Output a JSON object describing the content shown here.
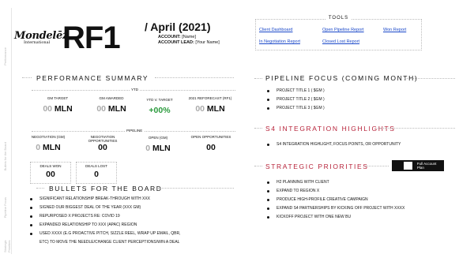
{
  "header": {
    "logo_text": "Mondelēz",
    "logo_sub": "International",
    "title": "RF1",
    "period": "/ April (2021)",
    "account_label": "ACCOUNT:",
    "account_value": "[Name]",
    "lead_label": "ACCOUNT LEAD:",
    "lead_value": "[Your Name]"
  },
  "side_labels": [
    "Strategic Priorities",
    "Pipeline Focus",
    "S4 Integration",
    "Bullets for the Board",
    "Performance",
    "Summary"
  ],
  "tools": {
    "title": "TOOLS",
    "links": [
      "Client Dashboard",
      "Open Pipeline Report",
      "Won Report",
      "In Negotiation Report",
      "Closed Lost Report"
    ]
  },
  "performance": {
    "title": "PERFORMANCE SUMMARY",
    "ytd_label": "YTD",
    "pipeline_label": "PIPELINE",
    "ytd": [
      {
        "label": "GM TARGET",
        "value_gray": "00",
        "value": "MLN"
      },
      {
        "label": "GM AWARDED",
        "value_gray": "00",
        "value": "MLN"
      },
      {
        "label": "YTD V. TARGET",
        "value": "+00%"
      },
      {
        "label": "2021 REFORECAST (RF1)",
        "value_gray": "00",
        "value": "MLN"
      }
    ],
    "pipeline": [
      {
        "label": "NEGOTIATION (GM)",
        "value_gray": "0",
        "value": "MLN"
      },
      {
        "label": "NEGOTIATION OPPORTUNITIES",
        "value": "00"
      },
      {
        "label": "OPEN (GM)",
        "value_gray": "0",
        "value": "MLN"
      },
      {
        "label": "OPEN OPPORTUNITIES",
        "value": "00"
      }
    ],
    "deals": [
      {
        "label": "DEALS WON",
        "value": "00"
      },
      {
        "label": "DEALS LOST",
        "value": "0"
      }
    ]
  },
  "bullets_board": {
    "title": "BULLETS FOR THE BOARD",
    "items": [
      "SIGNIFICANT RELATIONSHIP BREAK-THROUGH WITH XXX",
      "SIGNED OUR BIGGEST DEAL OF THE YEAR (XXX GM)",
      "REPURPOSED X PROJECTS RE: COVID 19",
      "EXPANDED RELATIONSHIP  TO XXX (APAC) REGION",
      "USED XXXX (E.G PROACTIVE PITCH, SIZZLE REEL, WRAP UP EMAIL, QBR,"
    ],
    "continuation": "ETC) TO MOVE THE NEEDLE/CHANGE CLIENT PERCEPTIONS/WIN A DEAL"
  },
  "pipeline_focus": {
    "title": "PIPELINE FOCUS (COMING  MONTH)",
    "items": [
      "PROJECT TITLE 1 ( $GM )",
      "PROJECT TITLE 2 ( $GM )",
      "PROJECT TITLE 3 ( $GM )"
    ]
  },
  "s4": {
    "title": "S4 INTEGRATION HIGHLIGHTS",
    "items": [
      "S4 INTEGRATION  HIGHLIGHT, FOCUS POINTS, OR OPPORTUNITY"
    ]
  },
  "strategic": {
    "title": "STRATEGIC PRIORITIES",
    "toggle_label": "Full Account Plan",
    "items": [
      "H2 PLANNING WITH CLIENT",
      "EXPAND TO REGION X",
      "PRODUCE HIGH-PROFILE CREATIVE CAMPAIGN",
      "EXPAND S4 PARTNERSHIPS BY KICKING OFF PROJECT WITH XXXX",
      "KICKOFF PROJECT  WITH ONE NEW BU"
    ]
  },
  "colors": {
    "accent_red": "#b7233a",
    "link_blue": "#1a48c9",
    "positive_green": "#2b9a3d"
  }
}
